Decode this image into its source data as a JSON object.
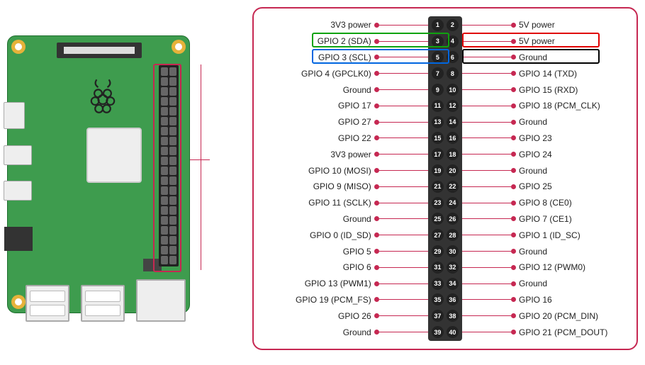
{
  "pins_left": [
    "3V3 power",
    "GPIO 2 (SDA)",
    "GPIO 3 (SCL)",
    "GPIO 4 (GPCLK0)",
    "Ground",
    "GPIO 17",
    "GPIO 27",
    "GPIO 22",
    "3V3 power",
    "GPIO 10 (MOSI)",
    "GPIO 9 (MISO)",
    "GPIO 11 (SCLK)",
    "Ground",
    "GPIO 0 (ID_SD)",
    "GPIO 5",
    "GPIO 6",
    "GPIO 13 (PWM1)",
    "GPIO 19 (PCM_FS)",
    "GPIO 26",
    "Ground"
  ],
  "pins_right": [
    "5V power",
    "5V power",
    "Ground",
    "GPIO 14 (TXD)",
    "GPIO 15 (RXD)",
    "GPIO 18 (PCM_CLK)",
    "Ground",
    "GPIO 23",
    "GPIO 24",
    "Ground",
    "GPIO 25",
    "GPIO 8 (CE0)",
    "GPIO 7 (CE1)",
    "GPIO 1 (ID_SC)",
    "Ground",
    "GPIO 12 (PWM0)",
    "Ground",
    "GPIO 16",
    "GPIO 20 (PCM_DIN)",
    "GPIO 21 (PCM_DOUT)"
  ],
  "highlights": {
    "green": "GPIO 2 (SDA) — pin 3",
    "red": "5V power — pin 4",
    "blue": "GPIO 3 (SCL) — pin 5",
    "black": "Ground — pin 6"
  },
  "chart_data": {
    "type": "table",
    "title": "Raspberry Pi 40-pin GPIO header pinout",
    "columns": [
      "physical_pin",
      "side",
      "label"
    ],
    "rows": [
      [
        1,
        "left",
        "3V3 power"
      ],
      [
        2,
        "right",
        "5V power"
      ],
      [
        3,
        "left",
        "GPIO 2 (SDA)"
      ],
      [
        4,
        "right",
        "5V power"
      ],
      [
        5,
        "left",
        "GPIO 3 (SCL)"
      ],
      [
        6,
        "right",
        "Ground"
      ],
      [
        7,
        "left",
        "GPIO 4 (GPCLK0)"
      ],
      [
        8,
        "right",
        "GPIO 14 (TXD)"
      ],
      [
        9,
        "left",
        "Ground"
      ],
      [
        10,
        "right",
        "GPIO 15 (RXD)"
      ],
      [
        11,
        "left",
        "GPIO 17"
      ],
      [
        12,
        "right",
        "GPIO 18 (PCM_CLK)"
      ],
      [
        13,
        "left",
        "GPIO 27"
      ],
      [
        14,
        "right",
        "Ground"
      ],
      [
        15,
        "left",
        "GPIO 22"
      ],
      [
        16,
        "right",
        "GPIO 23"
      ],
      [
        17,
        "left",
        "3V3 power"
      ],
      [
        18,
        "right",
        "GPIO 24"
      ],
      [
        19,
        "left",
        "GPIO 10 (MOSI)"
      ],
      [
        20,
        "right",
        "Ground"
      ],
      [
        21,
        "left",
        "GPIO 9 (MISO)"
      ],
      [
        22,
        "right",
        "GPIO 25"
      ],
      [
        23,
        "left",
        "GPIO 11 (SCLK)"
      ],
      [
        24,
        "right",
        "GPIO 8 (CE0)"
      ],
      [
        25,
        "left",
        "Ground"
      ],
      [
        26,
        "right",
        "GPIO 7 (CE1)"
      ],
      [
        27,
        "left",
        "GPIO 0 (ID_SD)"
      ],
      [
        28,
        "right",
        "GPIO 1 (ID_SC)"
      ],
      [
        29,
        "left",
        "GPIO 5"
      ],
      [
        30,
        "right",
        "Ground"
      ],
      [
        31,
        "left",
        "GPIO 6"
      ],
      [
        32,
        "right",
        "GPIO 12 (PWM0)"
      ],
      [
        33,
        "left",
        "GPIO 13 (PWM1)"
      ],
      [
        34,
        "right",
        "Ground"
      ],
      [
        35,
        "left",
        "GPIO 19 (PCM_FS)"
      ],
      [
        36,
        "right",
        "GPIO 16"
      ],
      [
        37,
        "left",
        "GPIO 26"
      ],
      [
        38,
        "right",
        "GPIO 20 (PCM_DIN)"
      ],
      [
        39,
        "left",
        "Ground"
      ],
      [
        40,
        "right",
        "GPIO 21 (PCM_DOUT)"
      ]
    ],
    "highlighted_pins": [
      {
        "pin": 3,
        "color": "green"
      },
      {
        "pin": 4,
        "color": "red"
      },
      {
        "pin": 5,
        "color": "blue"
      },
      {
        "pin": 6,
        "color": "black"
      }
    ]
  }
}
